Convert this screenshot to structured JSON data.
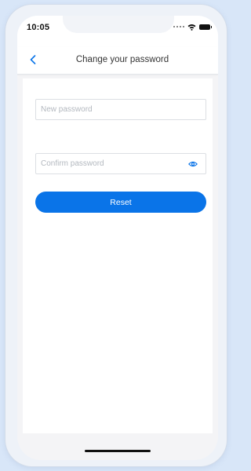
{
  "status_bar": {
    "time": "10:05"
  },
  "nav": {
    "title": "Change your password",
    "back_icon": "chevron-left-icon"
  },
  "form": {
    "new_password": {
      "value": "",
      "placeholder": "New password"
    },
    "confirm_password": {
      "value": "",
      "placeholder": "Confirm password",
      "toggle_icon": "eye-icon"
    },
    "reset_label": "Reset"
  },
  "colors": {
    "accent": "#0a74e8",
    "page_background": "#d8e6f8"
  }
}
